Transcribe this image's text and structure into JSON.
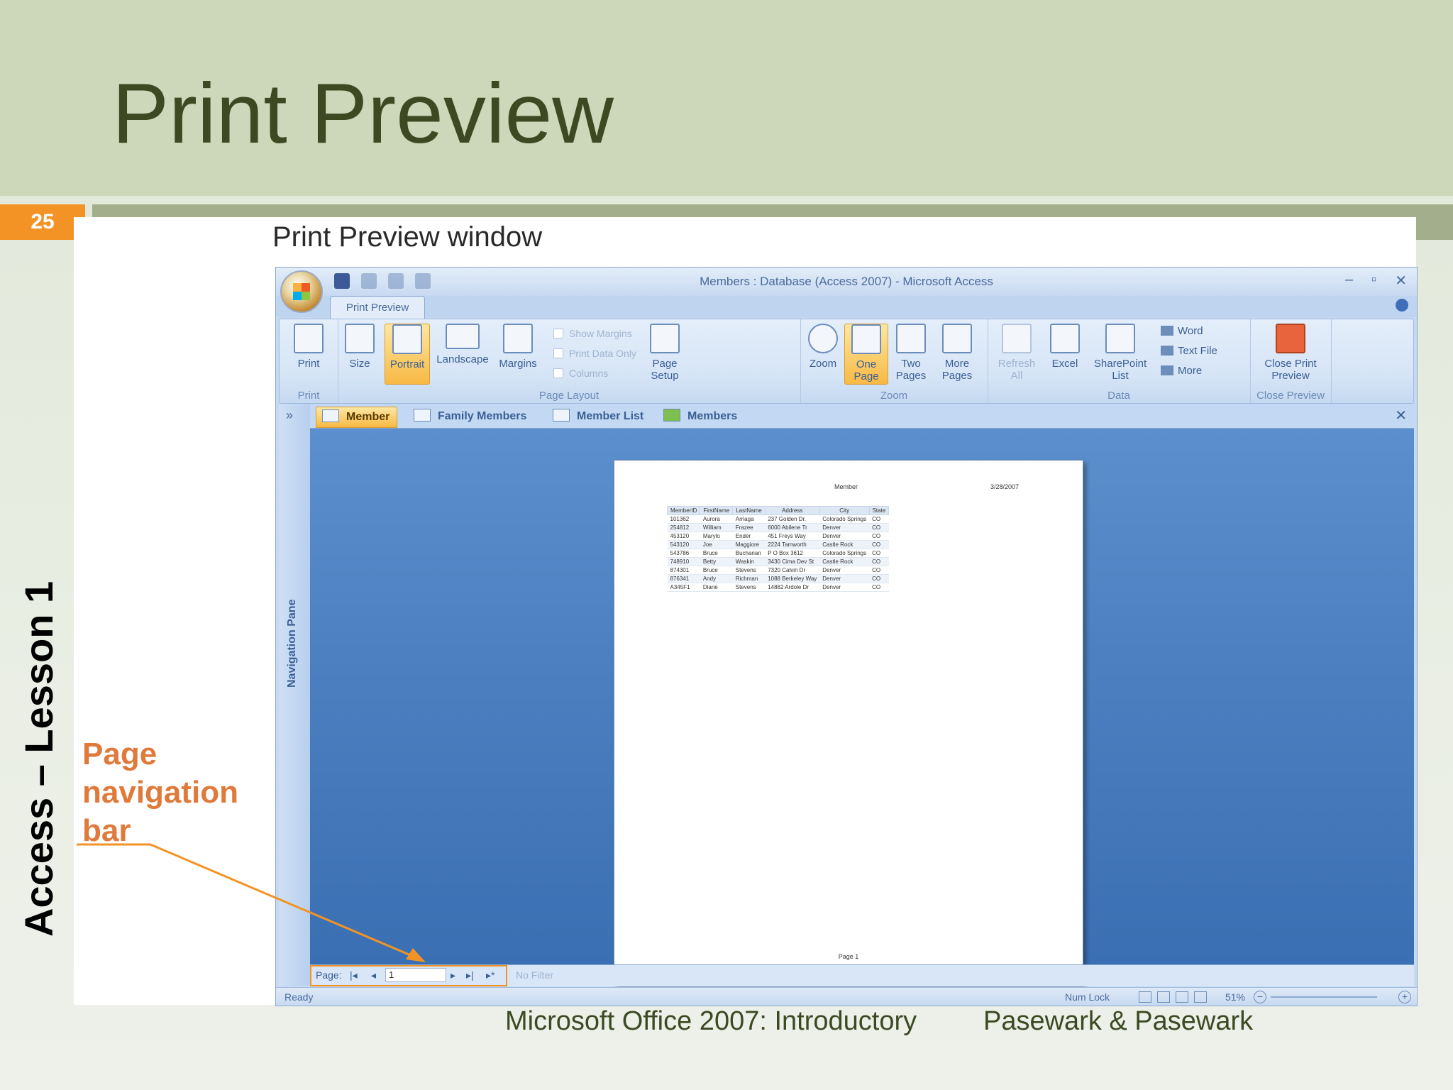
{
  "slide": {
    "title": "Print Preview",
    "number": "25",
    "side_label": "Access – Lesson 1",
    "window_caption": "Print Preview window",
    "annotation": [
      "Page",
      "navigation",
      "bar"
    ],
    "footer_course": "Microsoft Office 2007:  Introductory",
    "footer_author": "Pasewark & Pasewark",
    "colors": {
      "header_bg": "#cdd8bb",
      "title": "#3c4a23",
      "accent": "#f39325",
      "annotation": "#e07a3a"
    }
  },
  "app": {
    "title": "Members : Database (Access 2007) - Microsoft Access",
    "controls": [
      "–",
      "▫",
      "✕"
    ],
    "tab": "Print Preview",
    "ribbon": {
      "print": {
        "button": "Print",
        "group": "Print"
      },
      "page_layout": {
        "group": "Page Layout",
        "size": "Size",
        "portrait": "Portrait",
        "landscape": "Landscape",
        "margins": "Margins",
        "show_margins": "Show Margins",
        "print_data_only": "Print Data Only",
        "columns": "Columns",
        "page_setup": [
          "Page",
          "Setup"
        ]
      },
      "zoom": {
        "group": "Zoom",
        "zoom": "Zoom",
        "one_page": [
          "One",
          "Page"
        ],
        "two_pages": [
          "Two",
          "Pages"
        ],
        "more_pages": [
          "More",
          "Pages"
        ]
      },
      "data": {
        "group": "Data",
        "refresh": [
          "Refresh",
          "All"
        ],
        "excel": "Excel",
        "sharepoint": [
          "SharePoint",
          "List"
        ],
        "word": "Word",
        "text_file": "Text File",
        "more": "More"
      },
      "close": {
        "group": "Close Preview",
        "button": [
          "Close Print",
          "Preview"
        ]
      }
    },
    "nav_pane": {
      "label": "Navigation Pane",
      "toggle": "»"
    },
    "doc_tabs": [
      "Member",
      "Family Members",
      "Member List",
      "Members"
    ],
    "doc_close": "✕",
    "report": {
      "title": "Member",
      "date": "3/28/2007",
      "columns": [
        "MemberID",
        "FirstName",
        "LastName",
        "Address",
        "City",
        "State"
      ],
      "rows": [
        [
          "101362",
          "Aurora",
          "Arriaga",
          "237 Golden Dr.",
          "Colorado Springs",
          "CO"
        ],
        [
          "254812",
          "William",
          "Frazee",
          "6000 Abilene Tr",
          "Denver",
          "CO"
        ],
        [
          "453120",
          "Marylo",
          "Ender",
          "451 Freys Way",
          "Denver",
          "CO"
        ],
        [
          "543120",
          "Joe",
          "Maggiore",
          "2224 Tamworth",
          "Castle Rock",
          "CO"
        ],
        [
          "543786",
          "Bruce",
          "Buchanan",
          "P O Box 3612",
          "Colorado Springs",
          "CO"
        ],
        [
          "748910",
          "Betty",
          "Waskin",
          "3430 Cima Dev St",
          "Castle Rock",
          "CO"
        ],
        [
          "874301",
          "Bruce",
          "Stevens",
          "7320 Calvin Dr",
          "Denver",
          "CO"
        ],
        [
          "876341",
          "Andy",
          "Richman",
          "1088 Berkeley Way",
          "Denver",
          "CO"
        ],
        [
          "A345F1",
          "Diane",
          "Stevens",
          "14882 Ardole Dr",
          "Denver",
          "CO"
        ]
      ],
      "footer": "Page 1"
    },
    "page_nav": {
      "label": "Page:",
      "first": "|◂",
      "prev": "◂",
      "current": "1",
      "next": "▸",
      "last": "▸|",
      "new": "▸*",
      "filter": "No Filter"
    },
    "status": {
      "ready": "Ready",
      "num_lock": "Num Lock",
      "zoom": "51%",
      "minus": "−",
      "plus": "+"
    }
  }
}
